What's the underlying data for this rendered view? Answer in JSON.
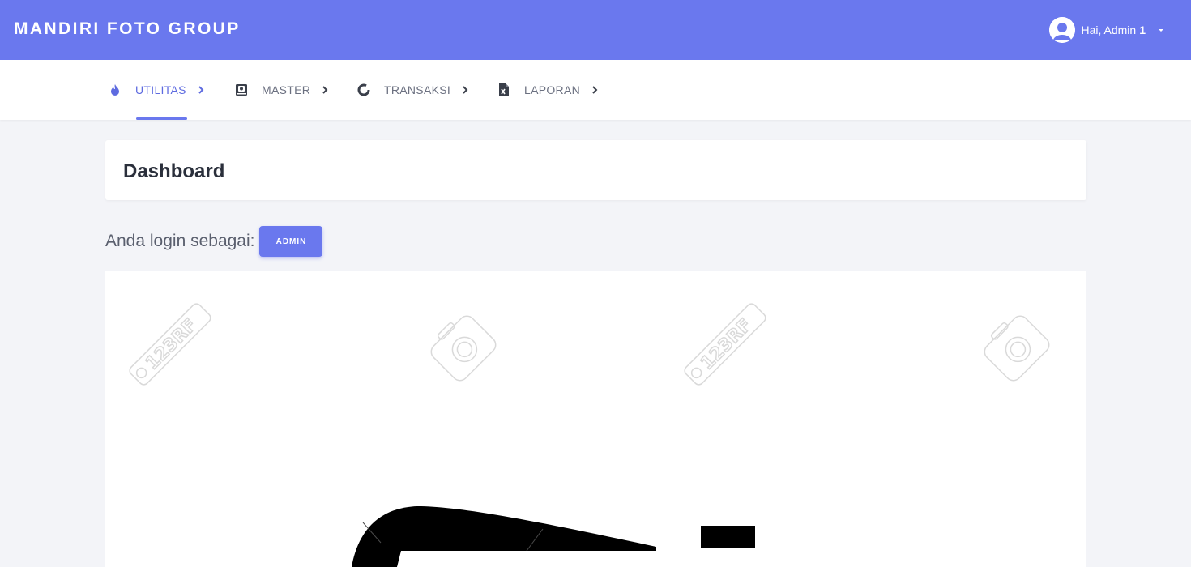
{
  "header": {
    "brand": "MANDIRI FOTO GROUP",
    "user_greeting": "Hai, Admin",
    "user_name": "1"
  },
  "nav": {
    "items": [
      {
        "label": "UTILITAS",
        "icon": "flame-icon",
        "active": true
      },
      {
        "label": "MASTER",
        "icon": "book-icon",
        "active": false
      },
      {
        "label": "TRANSAKSI",
        "icon": "spinner-icon",
        "active": false
      },
      {
        "label": "LAPORAN",
        "icon": "excel-file-icon",
        "active": false
      }
    ]
  },
  "page": {
    "title": "Dashboard",
    "login_prefix": "Anda login sebagai:",
    "role_badge": "ADMIN"
  },
  "watermark": {
    "text": "123RF"
  },
  "colors": {
    "primary": "#6a78ee",
    "background": "#f3f4f8",
    "text_dark": "#2a2f3b",
    "text_muted": "#6b7080"
  }
}
